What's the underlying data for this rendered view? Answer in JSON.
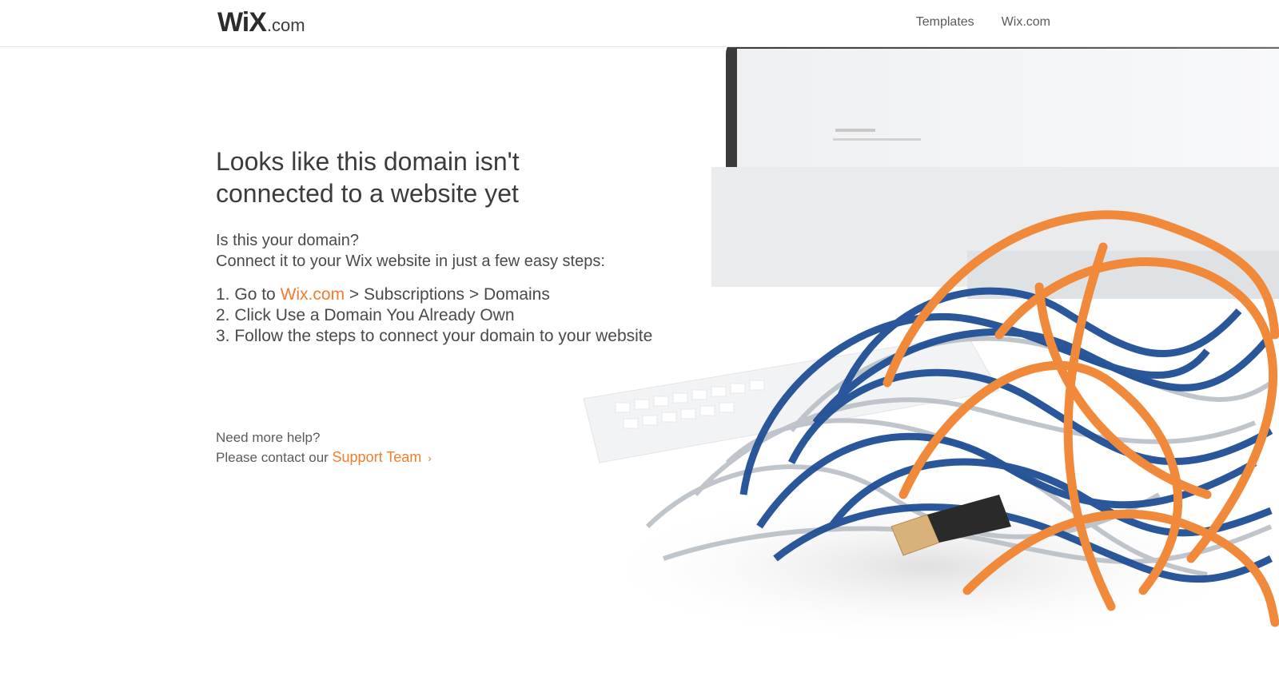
{
  "header": {
    "logo_wordmark": "WiX",
    "logo_suffix": ".com",
    "nav": [
      {
        "label": "Templates"
      },
      {
        "label": "Wix.com"
      }
    ]
  },
  "main": {
    "title_line1": "Looks like this domain isn't",
    "title_line2": "connected to a website yet",
    "question": "Is this your domain?",
    "intro": "Connect it to your Wix website in just a few easy steps:",
    "steps": [
      {
        "num": "1.",
        "prefix": "Go to ",
        "link": "Wix.com",
        "suffix": " > Subscriptions > Domains"
      },
      {
        "num": "2.",
        "text": "Click Use a Domain You Already Own"
      },
      {
        "num": "3.",
        "text": "Follow the steps to connect your domain to your website"
      }
    ]
  },
  "help": {
    "line1": "Need more help?",
    "line2_prefix": "Please contact our ",
    "link": "Support Team",
    "chevron": "›"
  },
  "colors": {
    "accent": "#f47c2c",
    "text": "#3c3c3c",
    "cable_orange": "#f0893a",
    "cable_blue": "#1f4f95",
    "cable_silver": "#b9bfc6"
  },
  "icons": {
    "hero": "tangled-cables-illustration"
  }
}
